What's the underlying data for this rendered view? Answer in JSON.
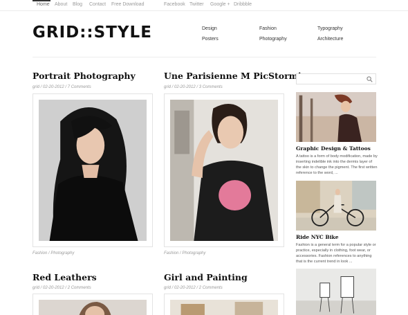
{
  "topnav": {
    "left": [
      "Home",
      "About",
      "Blog",
      "Contact",
      "Free Download"
    ],
    "right": [
      "Facebook",
      "Twitter",
      "Google +",
      "Dribbble"
    ]
  },
  "logo": "GRID::STYLE",
  "categories": [
    "Design",
    "Fashion",
    "Typography",
    "Posters",
    "Photography",
    "Architecture"
  ],
  "posts": [
    {
      "title": "Portrait Photography",
      "meta": "grid / 02-20-2012 / 7 Comments",
      "category": "Fashion / Photography"
    },
    {
      "title": "Une Parisienne M PicStorming",
      "meta": "grid / 02-20-2012 / 3 Comments",
      "category": "Fashion / Photography"
    },
    {
      "title": "Red Leathers",
      "meta": "grid / 02-20-2012 / 2 Comments"
    },
    {
      "title": "Girl and Painting",
      "meta": "grid / 02-20-2012 / 2 Comments"
    }
  ],
  "sidebar": {
    "search_placeholder": "",
    "items": [
      {
        "title": "Graphic Design & Tattoos",
        "excerpt": "A tattoo is a form of body modification, made by inserting indelible ink into the dermis layer of the skin to change the pigment. The first written reference to the word, ..."
      },
      {
        "title": "Ride NYC Bike",
        "excerpt": "Fashion is a general term for a popular style or practice, especially in clothing, foot wear, or accessories. Fashion references to anything that is the current trend in look ..."
      }
    ]
  },
  "colors": {
    "accent": "#111111",
    "muted": "#999999",
    "border": "#e3e3e3"
  }
}
